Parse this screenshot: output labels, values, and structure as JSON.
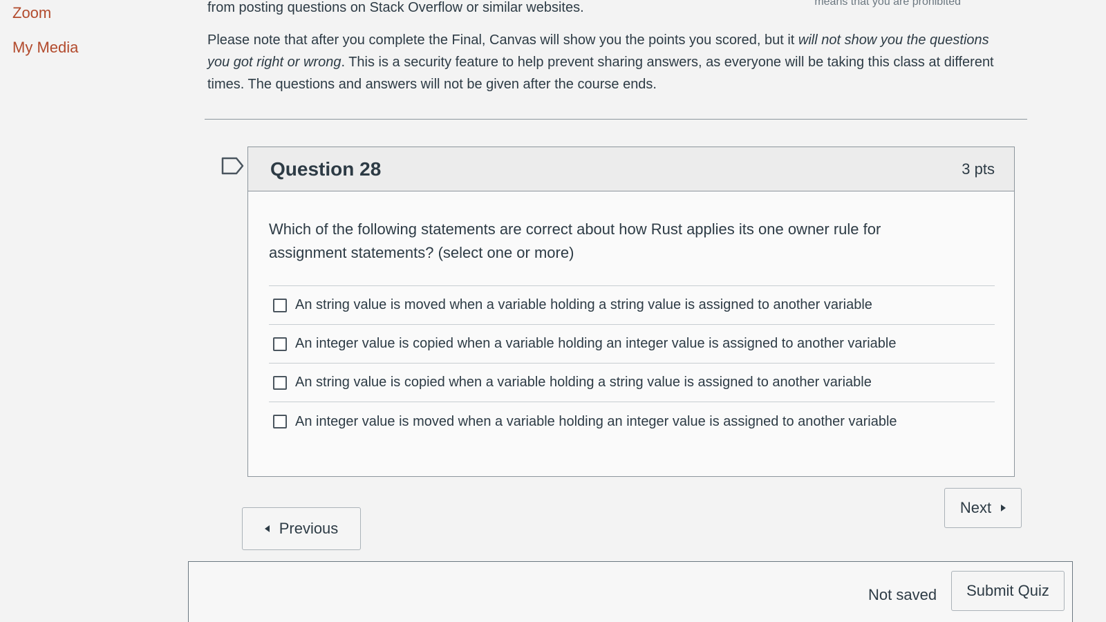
{
  "sidebar": {
    "items": [
      {
        "label": "Zoom"
      },
      {
        "label": "My Media"
      }
    ]
  },
  "intro": {
    "top_line": "from posting questions on Stack Overflow or similar websites.",
    "top_right": "means that you are prohibited",
    "notice_part1": "Please note that after you complete the Final, Canvas will show you the points you scored, but it ",
    "notice_emphasis": "will not show you the questions you got right or wrong",
    "notice_part2": ". This is a security feature to help prevent sharing answers, as everyone will be taking this class at different times. The questions and answers will not be given after the course ends."
  },
  "question": {
    "title": "Question 28",
    "points": "3 pts",
    "text": "Which of the following statements are correct about how Rust applies its one owner rule for assignment statements? (select one or more)",
    "answers": [
      {
        "label": "An string value is moved when a variable holding a string value is assigned to another variable",
        "checked": false
      },
      {
        "label": "An integer value is copied when a variable holding an integer value is assigned to another variable",
        "checked": false
      },
      {
        "label": "An string value is copied when a variable holding a string value is assigned to another variable",
        "checked": false
      },
      {
        "label": "An integer value is moved when a variable holding an integer value is assigned to another variable",
        "checked": false
      }
    ]
  },
  "nav": {
    "previous_label": "Previous",
    "next_label": "Next"
  },
  "footer": {
    "status": "Not saved",
    "submit_label": "Submit Quiz"
  },
  "colors": {
    "link": "#b24a2c",
    "text": "#2d3b45",
    "border": "#8c959c"
  }
}
